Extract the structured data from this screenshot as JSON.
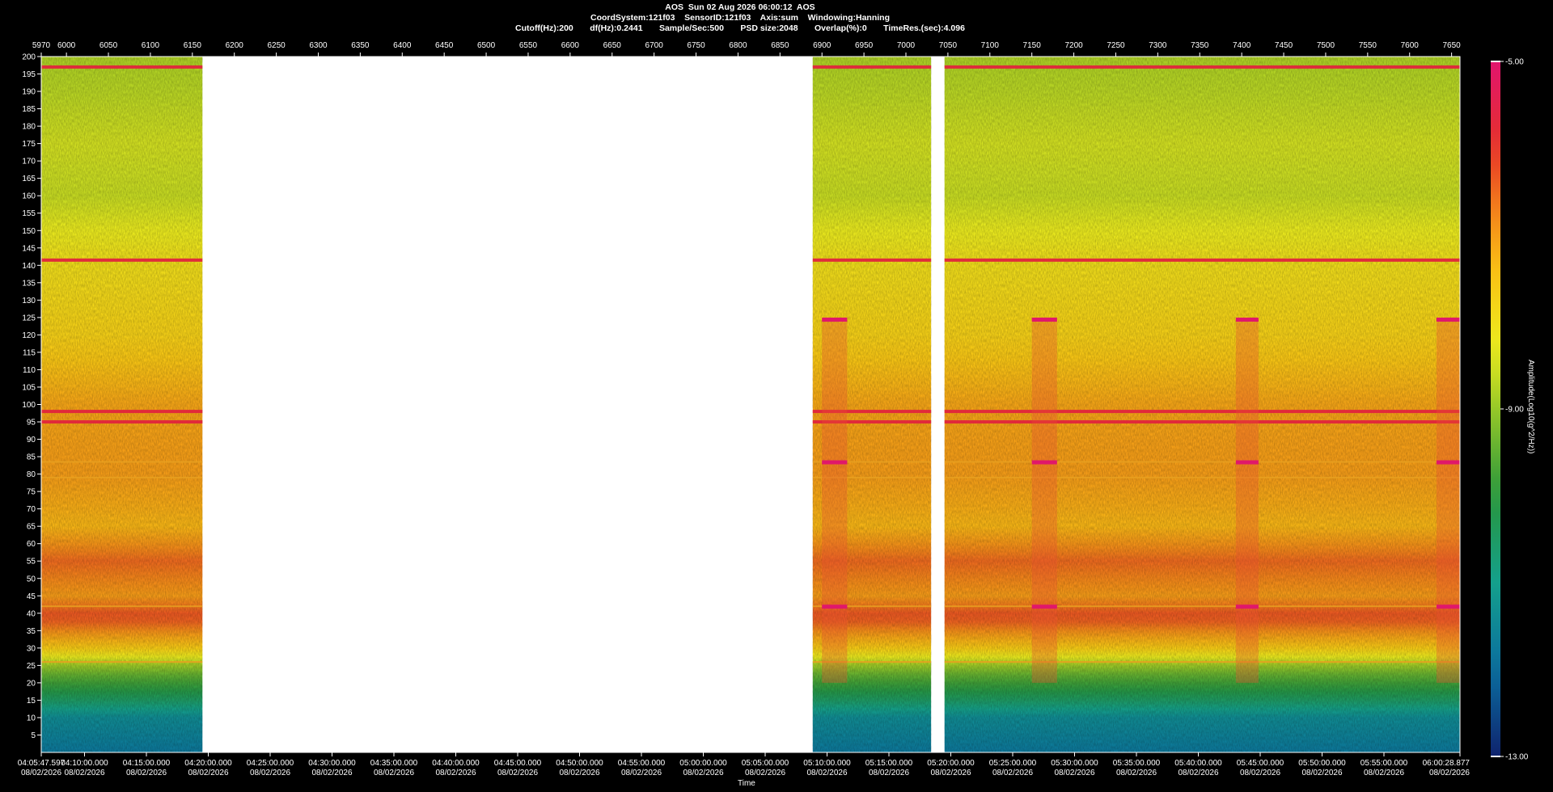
{
  "header": {
    "line1": "AOS  Sun 02 Aug 2026 06:00:12  AOS",
    "line2": "CoordSystem:121f03    SensorID:121f03    Axis:sum    Windowing:Hanning",
    "line3": "Cutoff(Hz):200       df(Hz):0.2441       Sample/Sec:500       PSD size:2048       Overlap(%):0       TimeRes.(sec):4.096"
  },
  "chart_data": {
    "type": "heatmap",
    "title": "AOS  Sun 02 Aug 2026 06:00:12  AOS",
    "xlabel": "Time",
    "ylabel": "",
    "colorbar_label": "Amplitude(Log10(g^2/Hz))",
    "colorbar_ticks": [
      "-5.00",
      "-9.00",
      "-13.00"
    ],
    "colorbar_range": [
      -13,
      -5
    ],
    "ylim": [
      0,
      200
    ],
    "y_ticks": [
      200,
      195,
      190,
      185,
      180,
      175,
      170,
      165,
      160,
      155,
      150,
      145,
      140,
      135,
      130,
      125,
      120,
      115,
      110,
      105,
      100,
      95,
      90,
      85,
      80,
      75,
      70,
      65,
      60,
      55,
      50,
      45,
      40,
      35,
      30,
      25,
      20,
      15,
      10,
      5
    ],
    "top_axis_range": [
      5970,
      7660
    ],
    "top_ticks": [
      5970,
      6000,
      6050,
      6100,
      6150,
      6200,
      6250,
      6300,
      6350,
      6400,
      6450,
      6500,
      6550,
      6600,
      6650,
      6700,
      6750,
      6800,
      6850,
      6900,
      6950,
      7000,
      7050,
      7100,
      7150,
      7200,
      7250,
      7300,
      7350,
      7400,
      7450,
      7500,
      7550,
      7600,
      7650
    ],
    "time_ticks": [
      {
        "time": "04:05:47.597",
        "date": "08/02/2026"
      },
      {
        "time": "04:10:00.000",
        "date": "08/02/2026"
      },
      {
        "time": "04:15:00.000",
        "date": "08/02/2026"
      },
      {
        "time": "04:20:00.000",
        "date": "08/02/2026"
      },
      {
        "time": "04:25:00.000",
        "date": "08/02/2026"
      },
      {
        "time": "04:30:00.000",
        "date": "08/02/2026"
      },
      {
        "time": "04:35:00.000",
        "date": "08/02/2026"
      },
      {
        "time": "04:40:00.000",
        "date": "08/02/2026"
      },
      {
        "time": "04:45:00.000",
        "date": "08/02/2026"
      },
      {
        "time": "04:50:00.000",
        "date": "08/02/2026"
      },
      {
        "time": "04:55:00.000",
        "date": "08/02/2026"
      },
      {
        "time": "05:00:00.000",
        "date": "08/02/2026"
      },
      {
        "time": "05:05:00.000",
        "date": "08/02/2026"
      },
      {
        "time": "05:10:00.000",
        "date": "08/02/2026"
      },
      {
        "time": "05:15:00.000",
        "date": "08/02/2026"
      },
      {
        "time": "05:20:00.000",
        "date": "08/02/2026"
      },
      {
        "time": "05:25:00.000",
        "date": "08/02/2026"
      },
      {
        "time": "05:30:00.000",
        "date": "08/02/2026"
      },
      {
        "time": "05:35:00.000",
        "date": "08/02/2026"
      },
      {
        "time": "05:40:00.000",
        "date": "08/02/2026"
      },
      {
        "time": "05:45:00.000",
        "date": "08/02/2026"
      },
      {
        "time": "05:50:00.000",
        "date": "08/02/2026"
      },
      {
        "time": "05:55:00.000",
        "date": "08/02/2026"
      },
      {
        "time": "06:00:28.877",
        "date": "08/02/2026"
      }
    ],
    "data_segments": [
      [
        5970,
        6162
      ],
      [
        6889,
        7030
      ],
      [
        7046,
        7660
      ]
    ],
    "strong_lines_hz": [
      197,
      141.5,
      98,
      95,
      83.5,
      79,
      42,
      26
    ],
    "transient_events": [
      [
        6900,
        6930
      ],
      [
        7150,
        7180
      ],
      [
        7393,
        7420
      ],
      [
        7632,
        7660
      ]
    ],
    "band_levels": [
      {
        "f": 200,
        "v": -8.8
      },
      {
        "f": 190,
        "v": -8.7
      },
      {
        "f": 175,
        "v": -8.5
      },
      {
        "f": 160,
        "v": -8.6
      },
      {
        "f": 140,
        "v": -8.0
      },
      {
        "f": 120,
        "v": -7.7
      },
      {
        "f": 100,
        "v": -7.1
      },
      {
        "f": 80,
        "v": -7.0
      },
      {
        "f": 65,
        "v": -7.3
      },
      {
        "f": 55,
        "v": -6.5
      },
      {
        "f": 45,
        "v": -7.0
      },
      {
        "f": 39,
        "v": -6.2
      },
      {
        "f": 30,
        "v": -7.6
      },
      {
        "f": 24,
        "v": -9.2
      },
      {
        "f": 15,
        "v": -10.5
      },
      {
        "f": 10,
        "v": -11.4
      },
      {
        "f": 0,
        "v": -11.8
      }
    ]
  }
}
